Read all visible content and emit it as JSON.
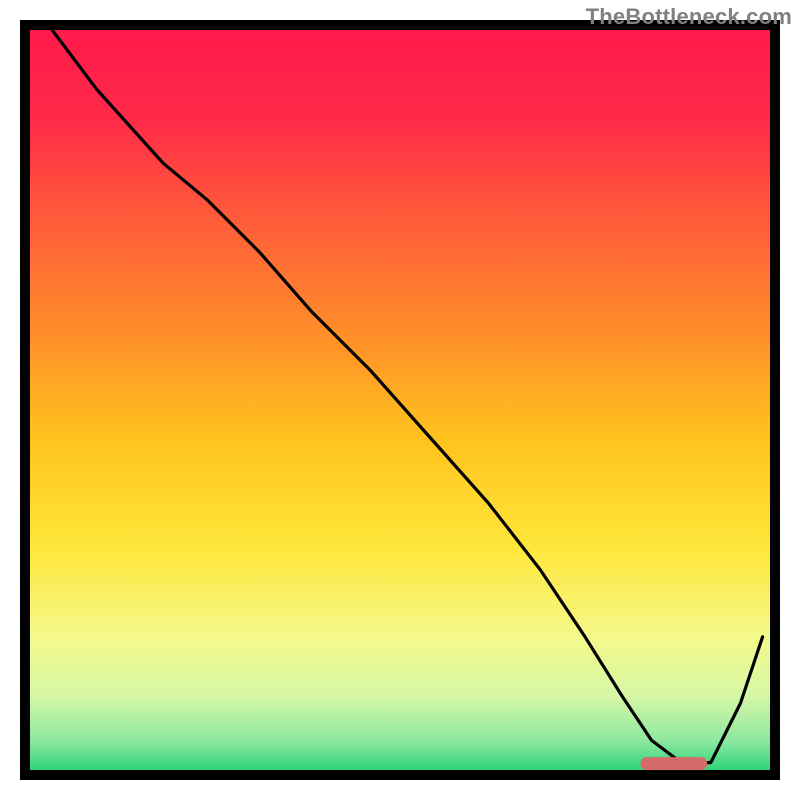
{
  "watermark": "TheBottleneck.com",
  "chart_data": {
    "type": "line",
    "title": "",
    "xlabel": "",
    "ylabel": "",
    "xlim": [
      0,
      100
    ],
    "ylim": [
      0,
      100
    ],
    "series": [
      {
        "name": "bottleneck-curve",
        "x": [
          3,
          9,
          18,
          24,
          31,
          38,
          46,
          54,
          62,
          69,
          75,
          80,
          84,
          88,
          92,
          96,
          99
        ],
        "y": [
          100,
          92,
          82,
          77,
          70,
          62,
          54,
          45,
          36,
          27,
          18,
          10,
          4,
          1,
          1,
          9,
          18
        ]
      }
    ],
    "marker": {
      "name": "optimal-range",
      "x_center": 87,
      "y": 0.8,
      "width": 9,
      "color": "#d46a6a"
    },
    "gradient_stops": [
      {
        "offset": 0.0,
        "color": "#ff1a4b"
      },
      {
        "offset": 0.12,
        "color": "#ff2a48"
      },
      {
        "offset": 0.25,
        "color": "#ff5a3a"
      },
      {
        "offset": 0.4,
        "color": "#ff8a2a"
      },
      {
        "offset": 0.55,
        "color": "#ffc21e"
      },
      {
        "offset": 0.7,
        "color": "#ffe63a"
      },
      {
        "offset": 0.82,
        "color": "#f5f98a"
      },
      {
        "offset": 0.9,
        "color": "#d6f7a6"
      },
      {
        "offset": 0.96,
        "color": "#8ee8a0"
      },
      {
        "offset": 1.0,
        "color": "#2fd37a"
      }
    ],
    "frame_color": "#000000",
    "line_color": "#000000"
  }
}
